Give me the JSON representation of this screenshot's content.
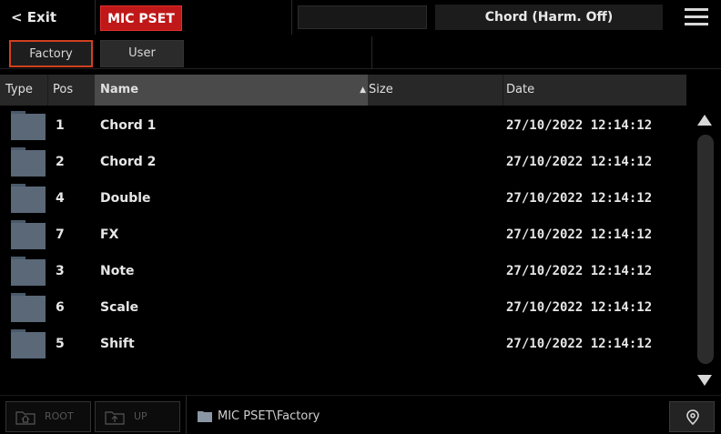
{
  "topbar": {
    "exit_label": "< Exit",
    "mic_pset_label": "MIC PSET",
    "blank_field": "",
    "preset_name": "Chord (Harm. Off)",
    "menu_icon": "hamburger-menu-icon"
  },
  "tabs": [
    {
      "label": "Factory",
      "active": true
    },
    {
      "label": "User",
      "active": false
    }
  ],
  "table": {
    "columns": {
      "type": "Type",
      "pos": "Pos",
      "name": "Name",
      "size": "Size",
      "date": "Date"
    },
    "sorted_by": "Name",
    "rows": [
      {
        "pos": "1",
        "name": "Chord 1",
        "size": "",
        "date": "27/10/2022 12:14:12",
        "icon": "folder-icon"
      },
      {
        "pos": "2",
        "name": "Chord 2",
        "size": "",
        "date": "27/10/2022 12:14:12",
        "icon": "folder-icon"
      },
      {
        "pos": "4",
        "name": "Double",
        "size": "",
        "date": "27/10/2022 12:14:12",
        "icon": "folder-icon"
      },
      {
        "pos": "7",
        "name": "FX",
        "size": "",
        "date": "27/10/2022 12:14:12",
        "icon": "folder-icon"
      },
      {
        "pos": "3",
        "name": "Note",
        "size": "",
        "date": "27/10/2022 12:14:12",
        "icon": "folder-icon"
      },
      {
        "pos": "6",
        "name": "Scale",
        "size": "",
        "date": "27/10/2022 12:14:12",
        "icon": "folder-icon"
      },
      {
        "pos": "5",
        "name": "Shift",
        "size": "",
        "date": "27/10/2022 12:14:12",
        "icon": "folder-icon"
      }
    ]
  },
  "bottombar": {
    "root_label": "ROOT",
    "up_label": "UP",
    "path": "MIC PSET\\Factory",
    "location_icon": "location-pin-icon"
  },
  "colors": {
    "accent_red": "#c01818",
    "tab_outline": "#d04020",
    "folder": "#5a6878",
    "header_bg": "#282828",
    "header_active": "#4a4a4a"
  }
}
